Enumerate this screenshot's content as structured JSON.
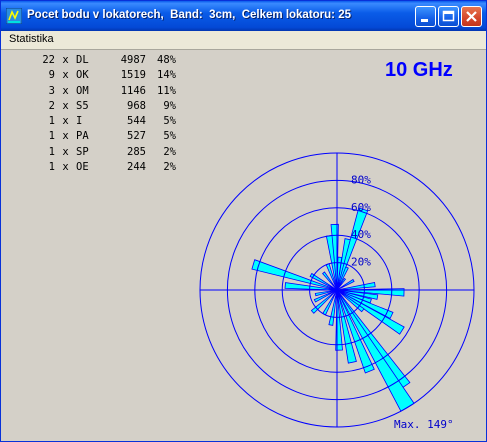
{
  "window": {
    "title": "Pocet bodu v lokatorech,  Band:  3cm,  Celkem lokatoru: 25"
  },
  "menu": {
    "items": [
      "Statistika"
    ]
  },
  "stats": {
    "rows": [
      {
        "count": "22",
        "sep": "x",
        "code": "DL",
        "value": "4987",
        "pct": "48%"
      },
      {
        "count": "9",
        "sep": "x",
        "code": "OK",
        "value": "1519",
        "pct": "14%"
      },
      {
        "count": "3",
        "sep": "x",
        "code": "OM",
        "value": "1146",
        "pct": "11%"
      },
      {
        "count": "2",
        "sep": "x",
        "code": "S5",
        "value": "968",
        "pct": "9%"
      },
      {
        "count": "1",
        "sep": "x",
        "code": "I",
        "value": "544",
        "pct": "5%"
      },
      {
        "count": "1",
        "sep": "x",
        "code": "PA",
        "value": "527",
        "pct": "5%"
      },
      {
        "count": "1",
        "sep": "x",
        "code": "SP",
        "value": "285",
        "pct": "2%"
      },
      {
        "count": "1",
        "sep": "x",
        "code": "OE",
        "value": "244",
        "pct": "2%"
      }
    ]
  },
  "band_label": "10 GHz",
  "chart_data": {
    "type": "polar-area",
    "ring_labels": [
      "20%",
      "40%",
      "60%",
      "80%"
    ],
    "ring_values": [
      20,
      40,
      60,
      80
    ],
    "max_value": 100,
    "max_label": "Max. 149°",
    "colors": {
      "fill": "#00ffff",
      "outline": "#0000ff",
      "grid": "#0000ff"
    },
    "sectors": [
      {
        "bearing": 12,
        "value": 38
      },
      {
        "bearing": 18,
        "value": 62
      },
      {
        "bearing": 24,
        "value": 18
      },
      {
        "bearing": 35,
        "value": 10
      },
      {
        "bearing": 60,
        "value": 14
      },
      {
        "bearing": 82,
        "value": 28
      },
      {
        "bearing": 92,
        "value": 49
      },
      {
        "bearing": 100,
        "value": 30
      },
      {
        "bearing": 108,
        "value": 26
      },
      {
        "bearing": 115,
        "value": 44
      },
      {
        "bearing": 122,
        "value": 56
      },
      {
        "bearing": 128,
        "value": 24
      },
      {
        "bearing": 145,
        "value": 86
      },
      {
        "bearing": 149,
        "value": 100
      },
      {
        "bearing": 158,
        "value": 64
      },
      {
        "bearing": 168,
        "value": 54
      },
      {
        "bearing": 178,
        "value": 44
      },
      {
        "bearing": 190,
        "value": 26
      },
      {
        "bearing": 208,
        "value": 20
      },
      {
        "bearing": 228,
        "value": 24
      },
      {
        "bearing": 244,
        "value": 18
      },
      {
        "bearing": 258,
        "value": 16
      },
      {
        "bearing": 275,
        "value": 38
      },
      {
        "bearing": 287,
        "value": 64
      },
      {
        "bearing": 300,
        "value": 22
      },
      {
        "bearing": 322,
        "value": 16
      },
      {
        "bearing": 340,
        "value": 20
      },
      {
        "bearing": 352,
        "value": 40
      },
      {
        "bearing": 358,
        "value": 48
      },
      {
        "bearing": 5,
        "value": 24
      }
    ]
  }
}
